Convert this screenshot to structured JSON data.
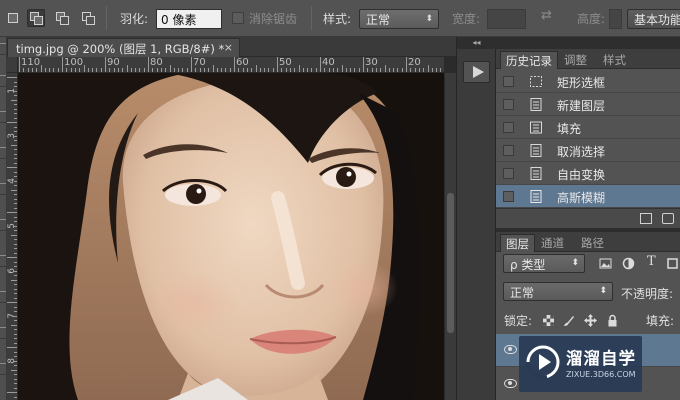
{
  "options_bar": {
    "feather_label": "羽化:",
    "feather_value": "0 像素",
    "antialias_label": "消除锯齿",
    "style_label": "样式:",
    "style_value": "正常",
    "width_label": "宽度:",
    "width_value": "",
    "height_label": "高度:",
    "workspace_button": "基本功能"
  },
  "document": {
    "tab_title": "timg.jpg @ 200% (图层 1, RGB/8#) *",
    "close_glyph": "×",
    "ruler_h_labels": [
      "110",
      "100",
      "90",
      "80",
      "70",
      "60",
      "50",
      "40",
      "30",
      "20"
    ],
    "ruler_v_labels": [
      "1",
      "3",
      "4",
      "5",
      "6",
      "7",
      "8"
    ]
  },
  "history_panel": {
    "tabs": [
      "历史记录",
      "调整",
      "样式"
    ],
    "active_tab": "历史记录",
    "items": [
      {
        "label": "矩形选框",
        "icon": "marquee-icon"
      },
      {
        "label": "新建图层",
        "icon": "history-state-icon"
      },
      {
        "label": "填充",
        "icon": "history-state-icon"
      },
      {
        "label": "取消选择",
        "icon": "history-state-icon"
      },
      {
        "label": "自由变换",
        "icon": "history-state-icon"
      },
      {
        "label": "高斯模糊",
        "icon": "history-state-icon"
      }
    ],
    "selected_index": 5
  },
  "layers_panel": {
    "tabs": [
      "图层",
      "通道",
      "路径"
    ],
    "active_tab": "图层",
    "filter_kind": "ρ 类型",
    "blend_mode": "正常",
    "opacity_label": "不透明度:",
    "lock_label": "锁定:",
    "fill_label": "填充:"
  },
  "watermark": {
    "title": "溜溜自学",
    "url": "ZIXUE.3D66.COM"
  },
  "colors": {
    "panel_bg": "#535353",
    "selection_blue": "#5f7892",
    "watermark_bg": "#283a54"
  }
}
